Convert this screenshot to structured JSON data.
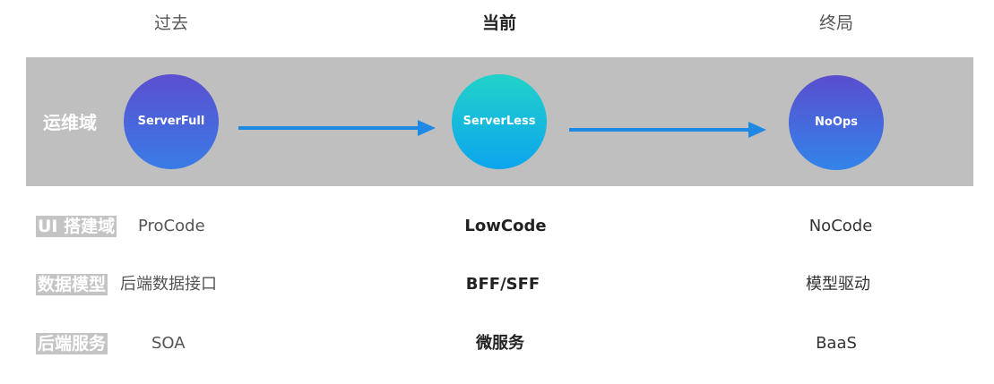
{
  "columns": {
    "past": "过去",
    "current": "当前",
    "end": "终局"
  },
  "ops_domain": {
    "label": "运维域",
    "past": "ServerFull",
    "current": "ServerLess",
    "end": "NoOps"
  },
  "rows": [
    {
      "label": "UI 搭建域",
      "past": "ProCode",
      "current": "LowCode",
      "end": "NoCode"
    },
    {
      "label": "数据模型",
      "past": "后端数据接口",
      "current": "BFF/SFF",
      "end": "模型驱动"
    },
    {
      "label": "后端服务",
      "past": "SOA",
      "current": "微服务",
      "end": "BaaS"
    }
  ],
  "colors": {
    "band": "#bfbfbf",
    "arrow": "#1e88e5"
  }
}
